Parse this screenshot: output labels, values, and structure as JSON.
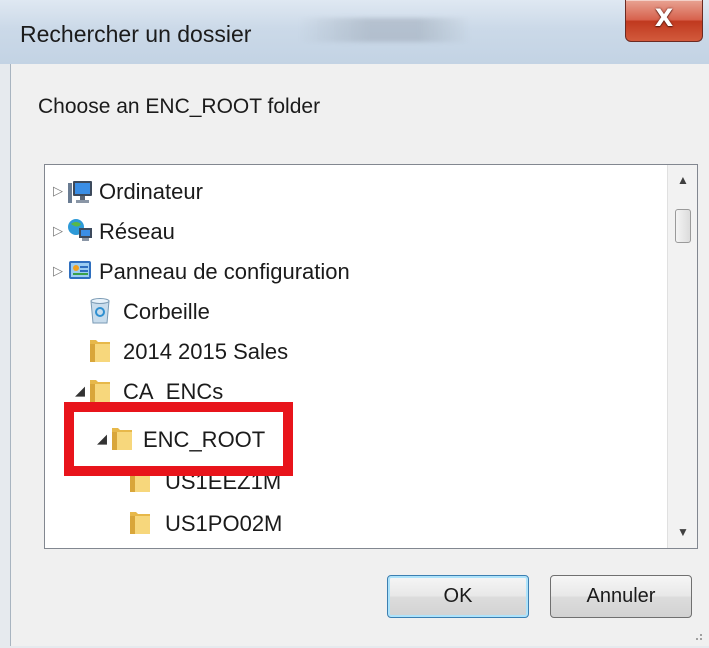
{
  "window": {
    "title": "Rechercher un dossier",
    "close_label": "X"
  },
  "dialog": {
    "prompt": "Choose an ENC_ROOT folder"
  },
  "tree": {
    "items": [
      {
        "label": "Ordinateur",
        "icon": "computer-icon",
        "expander": "collapsed"
      },
      {
        "label": "Réseau",
        "icon": "network-icon",
        "expander": "collapsed"
      },
      {
        "label": "Panneau de configuration",
        "icon": "control-panel-icon",
        "expander": "collapsed"
      },
      {
        "label": "Corbeille",
        "icon": "recycle-bin-icon",
        "expander": "none"
      },
      {
        "label": "2014 2015 Sales",
        "icon": "folder-icon",
        "expander": "none"
      },
      {
        "label": "CA_ENCs",
        "icon": "folder-icon",
        "expander": "expanded"
      },
      {
        "label": "ENC_ROOT",
        "icon": "folder-icon",
        "expander": "expanded",
        "selected": true
      },
      {
        "label": "US1EEZ1M",
        "icon": "folder-icon",
        "expander": "none"
      },
      {
        "label": "US1PO02M",
        "icon": "folder-icon",
        "expander": "none"
      }
    ]
  },
  "buttons": {
    "ok_label": "OK",
    "cancel_label": "Annuler"
  },
  "colors": {
    "highlight": "#e8141b",
    "selection": "#e4f0fb",
    "close_button": "#c7432a"
  }
}
